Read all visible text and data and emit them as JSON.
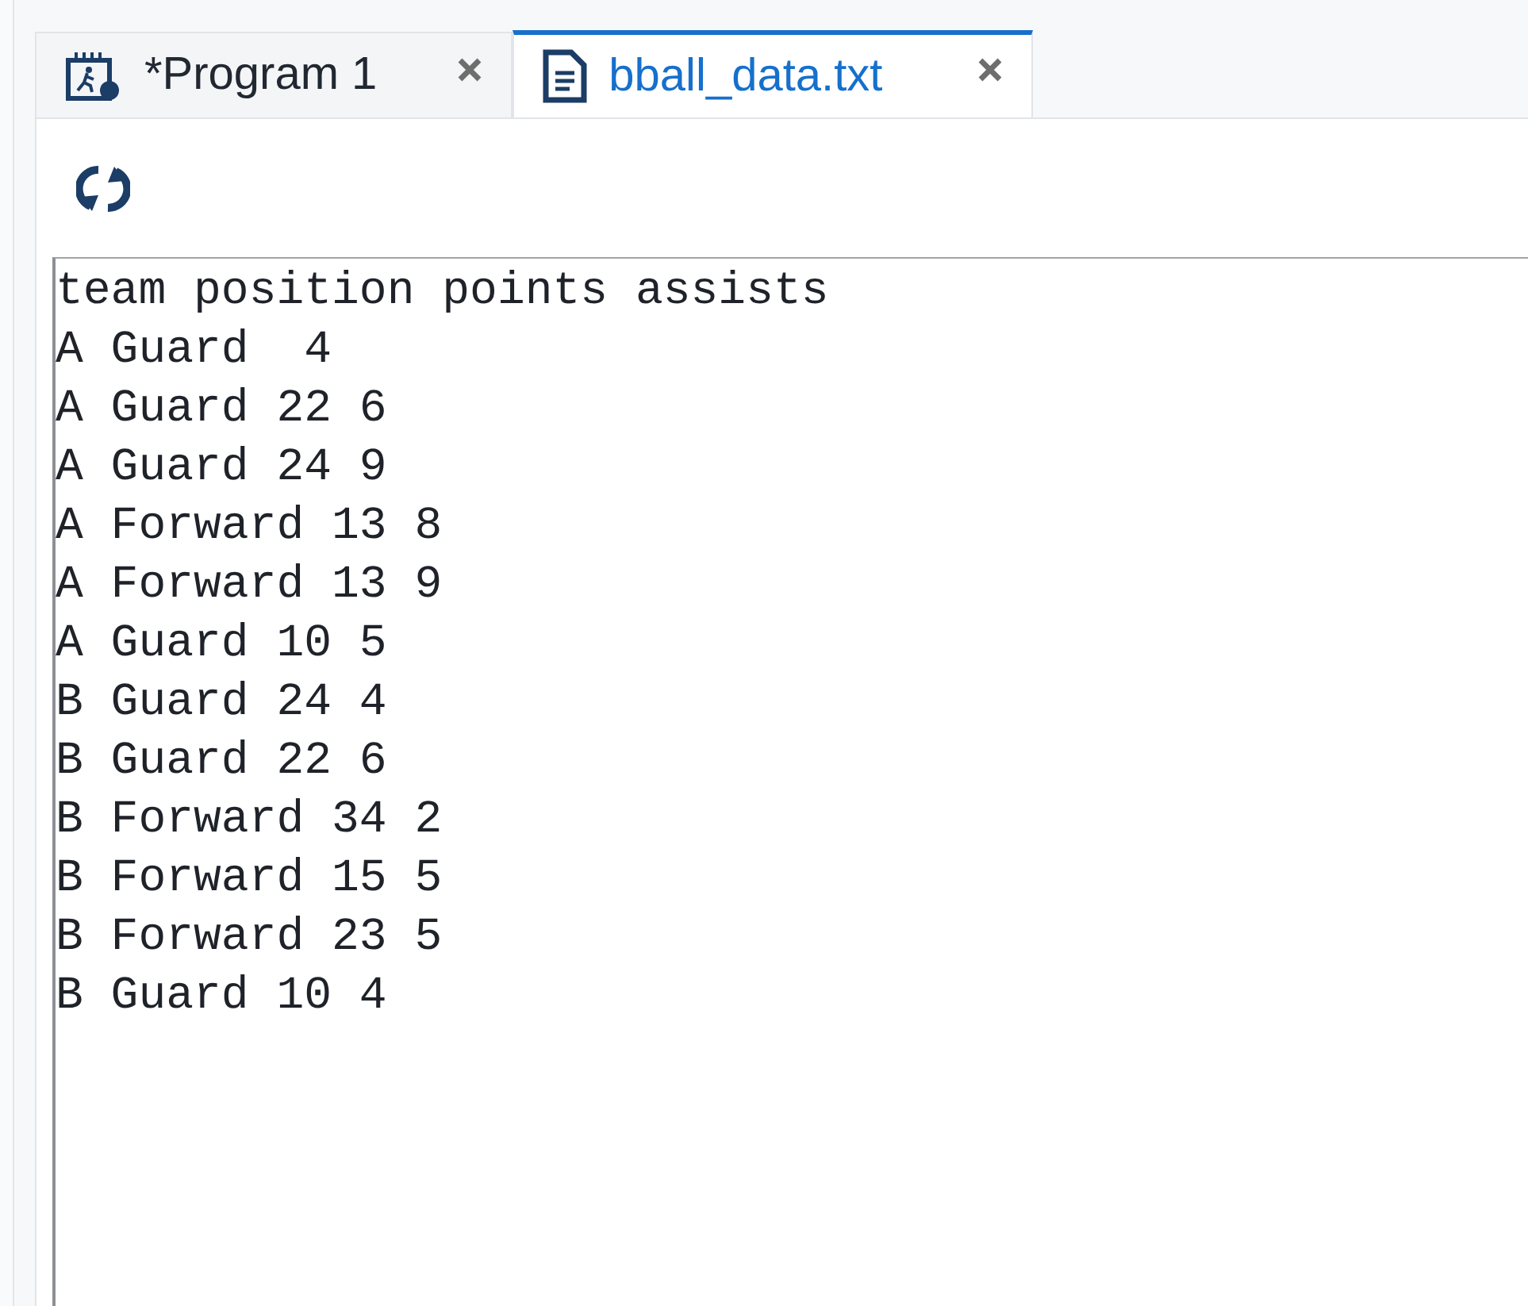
{
  "tabs": [
    {
      "label": "*Program 1",
      "kind": "program",
      "selected": false
    },
    {
      "label": "bball_data.txt",
      "kind": "text-file",
      "selected": true
    }
  ],
  "editor": {
    "lines": [
      "team position points assists",
      "A Guard  4",
      "A Guard 22 6",
      "A Guard 24 9",
      "A Forward 13 8",
      "A Forward 13 9",
      "A Guard 10 5",
      "B Guard 24 4",
      "B Guard 22 6",
      "B Forward 34 2",
      "B Forward 15 5",
      "B Forward 23 5",
      "B Guard 10 4"
    ]
  }
}
